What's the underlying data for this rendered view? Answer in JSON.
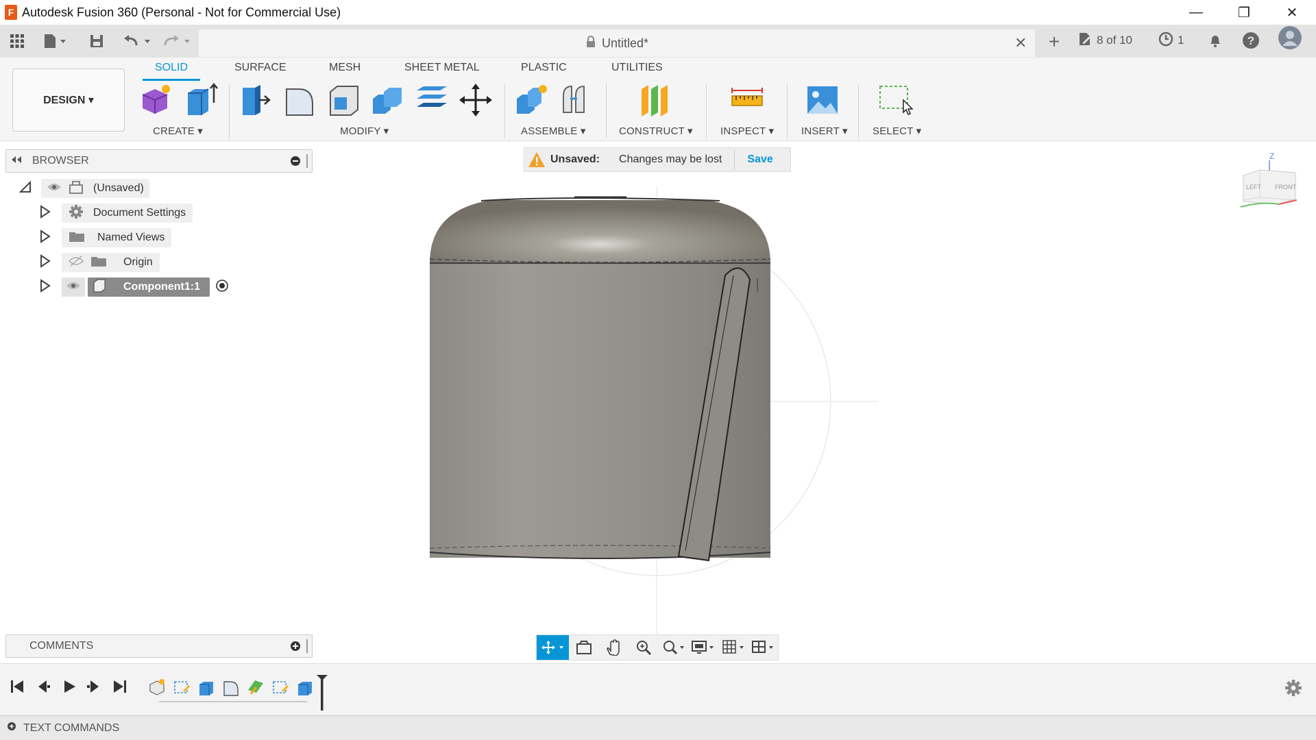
{
  "window": {
    "title": "Autodesk Fusion 360 (Personal - Not for Commercial Use)",
    "app_icon_letter": "F",
    "min": "—",
    "restore": "❐",
    "close": "✕"
  },
  "quickbar": {
    "doc_title": "Untitled*",
    "doc_close": "✕",
    "new_tab": "+",
    "job_status": "8 of 10",
    "timer_count": "1"
  },
  "toolbar": {
    "workspace": "DESIGN ▾",
    "tabs": [
      "SOLID",
      "SURFACE",
      "MESH",
      "SHEET METAL",
      "PLASTIC",
      "UTILITIES"
    ],
    "groups": {
      "create": "CREATE ▾",
      "modify": "MODIFY ▾",
      "assemble": "ASSEMBLE ▾",
      "construct": "CONSTRUCT ▾",
      "inspect": "INSPECT ▾",
      "insert": "INSERT ▾",
      "select": "SELECT ▾"
    }
  },
  "browser": {
    "title": "BROWSER",
    "root": "(Unsaved)",
    "items": [
      "Document Settings",
      "Named Views",
      "Origin",
      "Component1:1"
    ]
  },
  "unsaved_bar": {
    "label": "Unsaved:",
    "message": "Changes may be lost",
    "save": "Save"
  },
  "comments": {
    "title": "COMMENTS"
  },
  "viewcube": {
    "axis_z": "Z",
    "left": "LEFT",
    "front": "FRONT"
  },
  "text_commands": {
    "title": "TEXT COMMANDS"
  },
  "colors": {
    "accent": "#0696d7",
    "model": "#8f8c85"
  }
}
